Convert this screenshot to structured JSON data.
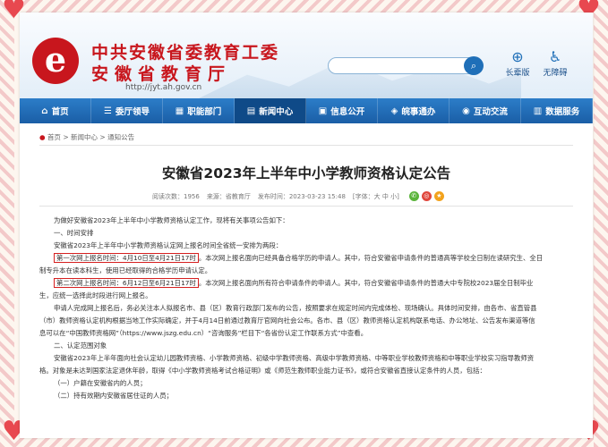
{
  "site": {
    "title_line1": "中共安徽省委教育工委",
    "title_line2": "安徽省教育厅",
    "logo_glyph": "e",
    "url": "http://jyt.ah.gov.cn",
    "search_placeholder": "",
    "elder_label": "长辈版",
    "barrier_label": "无障碍",
    "brand_color": "#c8161d",
    "nav_color": "#1a5ea6"
  },
  "nav": {
    "items": [
      {
        "label": "首页",
        "icon": "home-icon"
      },
      {
        "label": "委厅领导",
        "icon": "users-icon"
      },
      {
        "label": "职能部门",
        "icon": "org-icon"
      },
      {
        "label": "新闻中心",
        "icon": "news-icon"
      },
      {
        "label": "信息公开",
        "icon": "doc-icon"
      },
      {
        "label": "皖事通办",
        "icon": "service-icon"
      },
      {
        "label": "互动交流",
        "icon": "chat-icon"
      },
      {
        "label": "数据服务",
        "icon": "data-icon"
      }
    ],
    "active_index": 3
  },
  "breadcrumb": {
    "home": "首页",
    "sep1": ">",
    "news": "新闻中心",
    "sep2": ">",
    "notice": "通知公告"
  },
  "article": {
    "title": "安徽省2023年上半年中小学教师资格认定公告",
    "views_label": "阅读次数：1956",
    "source_label": "来源：省教育厅",
    "time_label": "发布时间：2023-03-23 15:48",
    "font_label": "[字体：大 中 小]",
    "p1": "为做好安徽省2023年上半年中小学教师资格认定工作，现将有关事项公告如下：",
    "h1": "一、时间安排",
    "p2": "安徽省2023年上半年中小学教师资格认定网上报名时间全省统一安排为两段：",
    "r1_hl": "第一次网上报名时间：4月10日至4月21日17时",
    "r1_rest": "。本次网上报名面向已经具备合格学历的申请人。其中，符合安徽省申请条件的普通高等学校全日制在读研究生、全日",
    "r1_cont": "制专升本在读本科生，使用已经取得的合格学历申请认定。",
    "r2_hl": "第二次网上报名时间：6月12日至6月21日17时",
    "r2_rest": "。本次网上报名面向所有符合申请条件的申请人。其中，符合安徽省申请条件的普通大中专院校2023届全日制毕业",
    "r2_cont": "生，应统一选择此时段进行网上报名。",
    "p3a": "申请人完成网上报名后，务必关注本人拟报名市、县（区）教育行政部门发布的公告，按照要求在规定时间内完成体检、现场确认。具体时间安排，由各市、省直管县",
    "p3b": "（市）教师资格认定机构根据当地工作实际确定，并于4月14日前通过教育厅官网向社会公布。各市、县（区）教师资格认定机构联系电话、办公地址、公告发布渠道等信",
    "p3c": "息可以在“中国教师资格网”（https://www.jszg.edu.cn）“咨询服务”栏目下“各省份认定工作联系方式”中查看。",
    "h2": "二、认定范围对象",
    "p4a": "安徽省2023年上半年面向社会认定幼儿园教师资格、小学教师资格、初级中学教师资格、高级中学教师资格、中等职业学校教师资格和中等职业学校实习指导教师资",
    "p4b": "格。对象是未达到国家法定退休年龄，取得《中小学教师资格考试合格证明》或《师范生教师职业能力证书》，或符合安徽省直接认定条件的人员，包括：",
    "i1": "（一）户籍在安徽省内的人员；",
    "i2": "（二）持有效期内安徽省居住证的人员；"
  }
}
